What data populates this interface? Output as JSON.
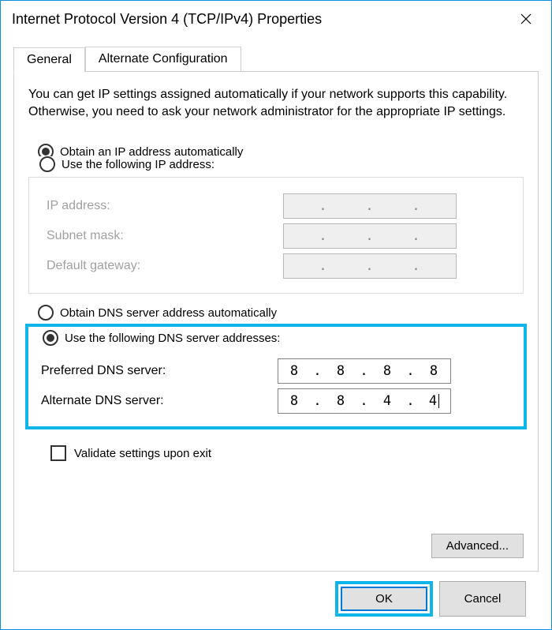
{
  "window": {
    "title": "Internet Protocol Version 4 (TCP/IPv4) Properties"
  },
  "tabs": {
    "general": "General",
    "alternate": "Alternate Configuration"
  },
  "description": "You can get IP settings assigned automatically if your network supports this capability. Otherwise, you need to ask your network administrator for the appropriate IP settings.",
  "ip": {
    "obtain_auto": "Obtain an IP address automatically",
    "use_following": "Use the following IP address:",
    "ip_address_label": "IP address:",
    "subnet_label": "Subnet mask:",
    "gateway_label": "Default gateway:"
  },
  "dns": {
    "obtain_auto": "Obtain DNS server address automatically",
    "use_following": "Use the following DNS server addresses:",
    "preferred_label": "Preferred DNS server:",
    "alternate_label": "Alternate DNS server:",
    "preferred_value": {
      "o1": "8",
      "o2": "8",
      "o3": "8",
      "o4": "8"
    },
    "alternate_value": {
      "o1": "8",
      "o2": "8",
      "o3": "4",
      "o4": "4"
    }
  },
  "validate_label": "Validate settings upon exit",
  "buttons": {
    "advanced": "Advanced...",
    "ok": "OK",
    "cancel": "Cancel"
  }
}
